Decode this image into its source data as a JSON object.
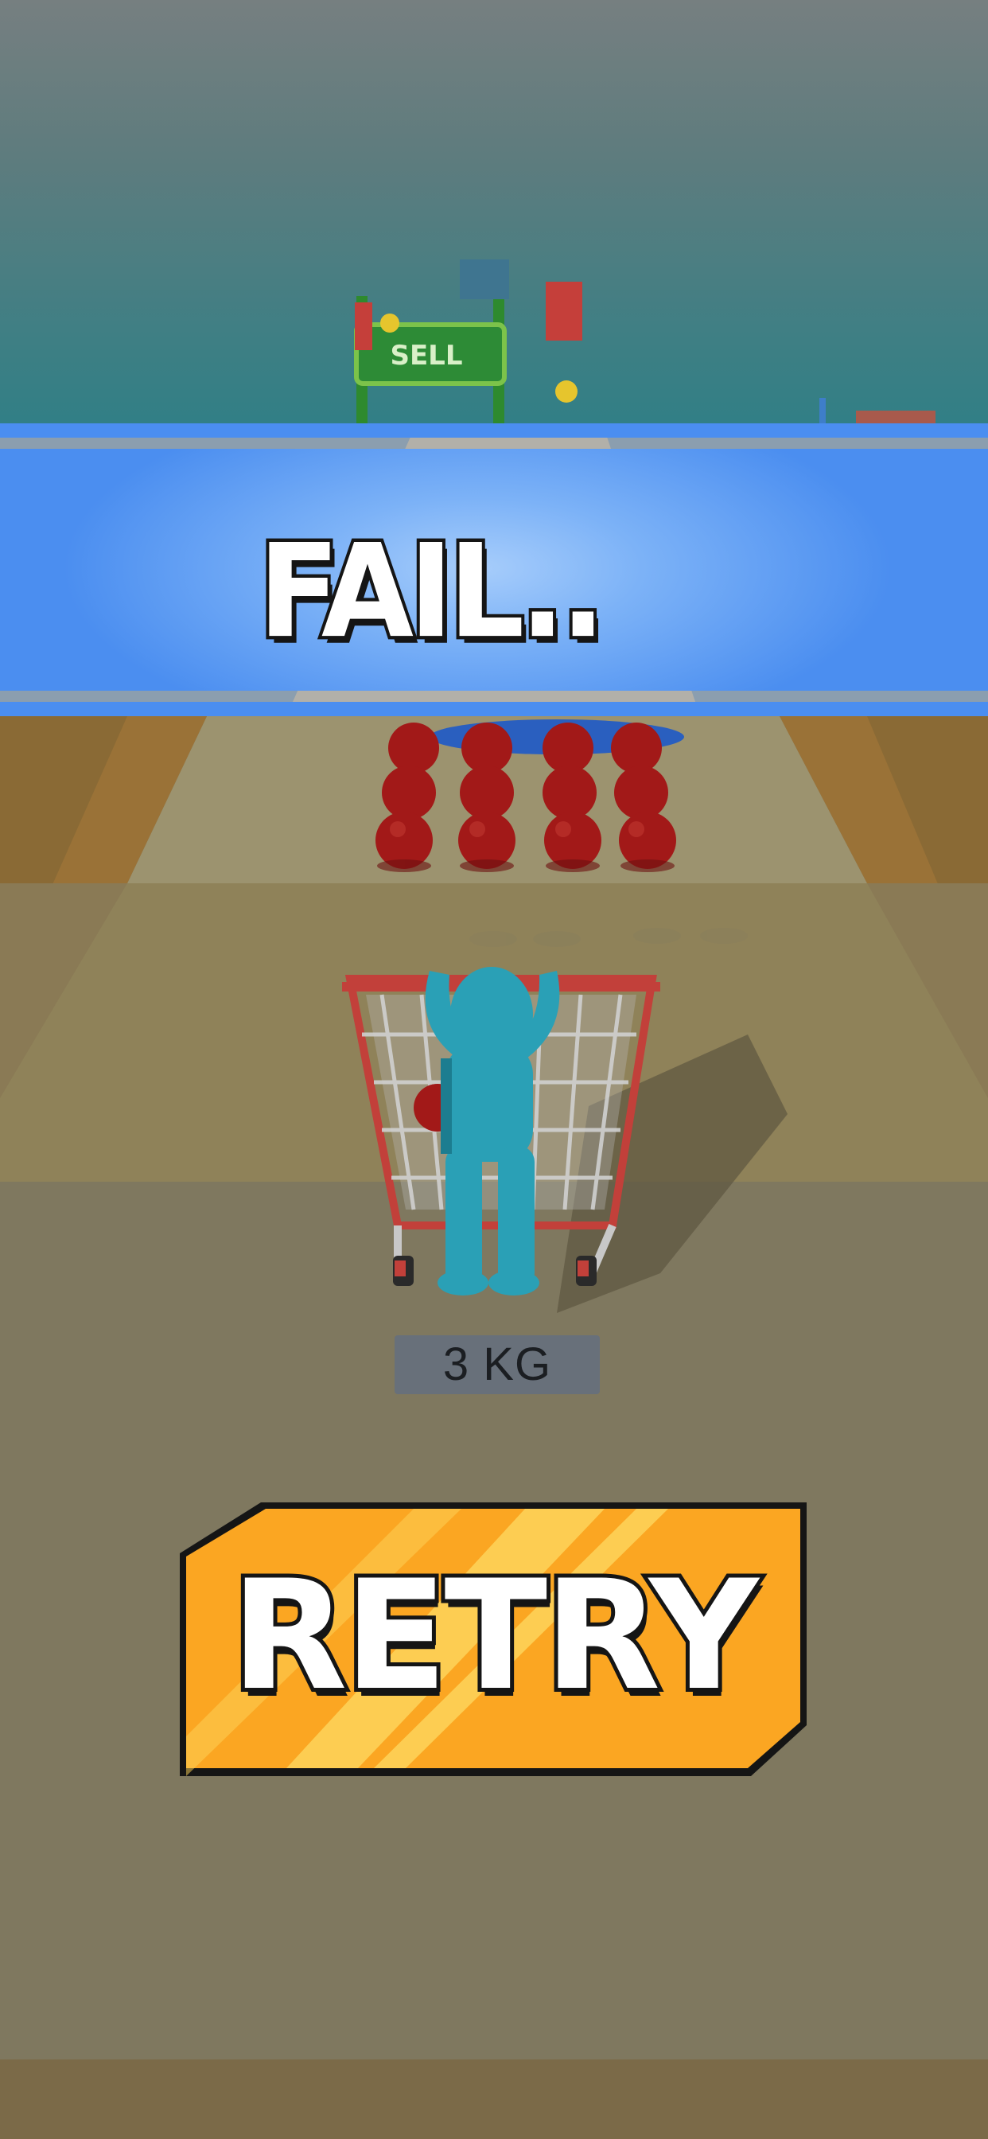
{
  "game": {
    "sell_sign": "SELL",
    "status_title": "FAIL..",
    "cart_weight": "3 KG",
    "retry_label": "RETRY"
  },
  "colors": {
    "banner": "#4b8ef0",
    "retry_button": "#fba622",
    "retry_highlight": "#fdd35a",
    "character": "#2aa0b6",
    "apple": "#a21918",
    "sell_sign_green": "#1f7a3c"
  },
  "icons": [
    "sell-gate",
    "apple-obstacle",
    "shopping-cart",
    "player-character"
  ]
}
